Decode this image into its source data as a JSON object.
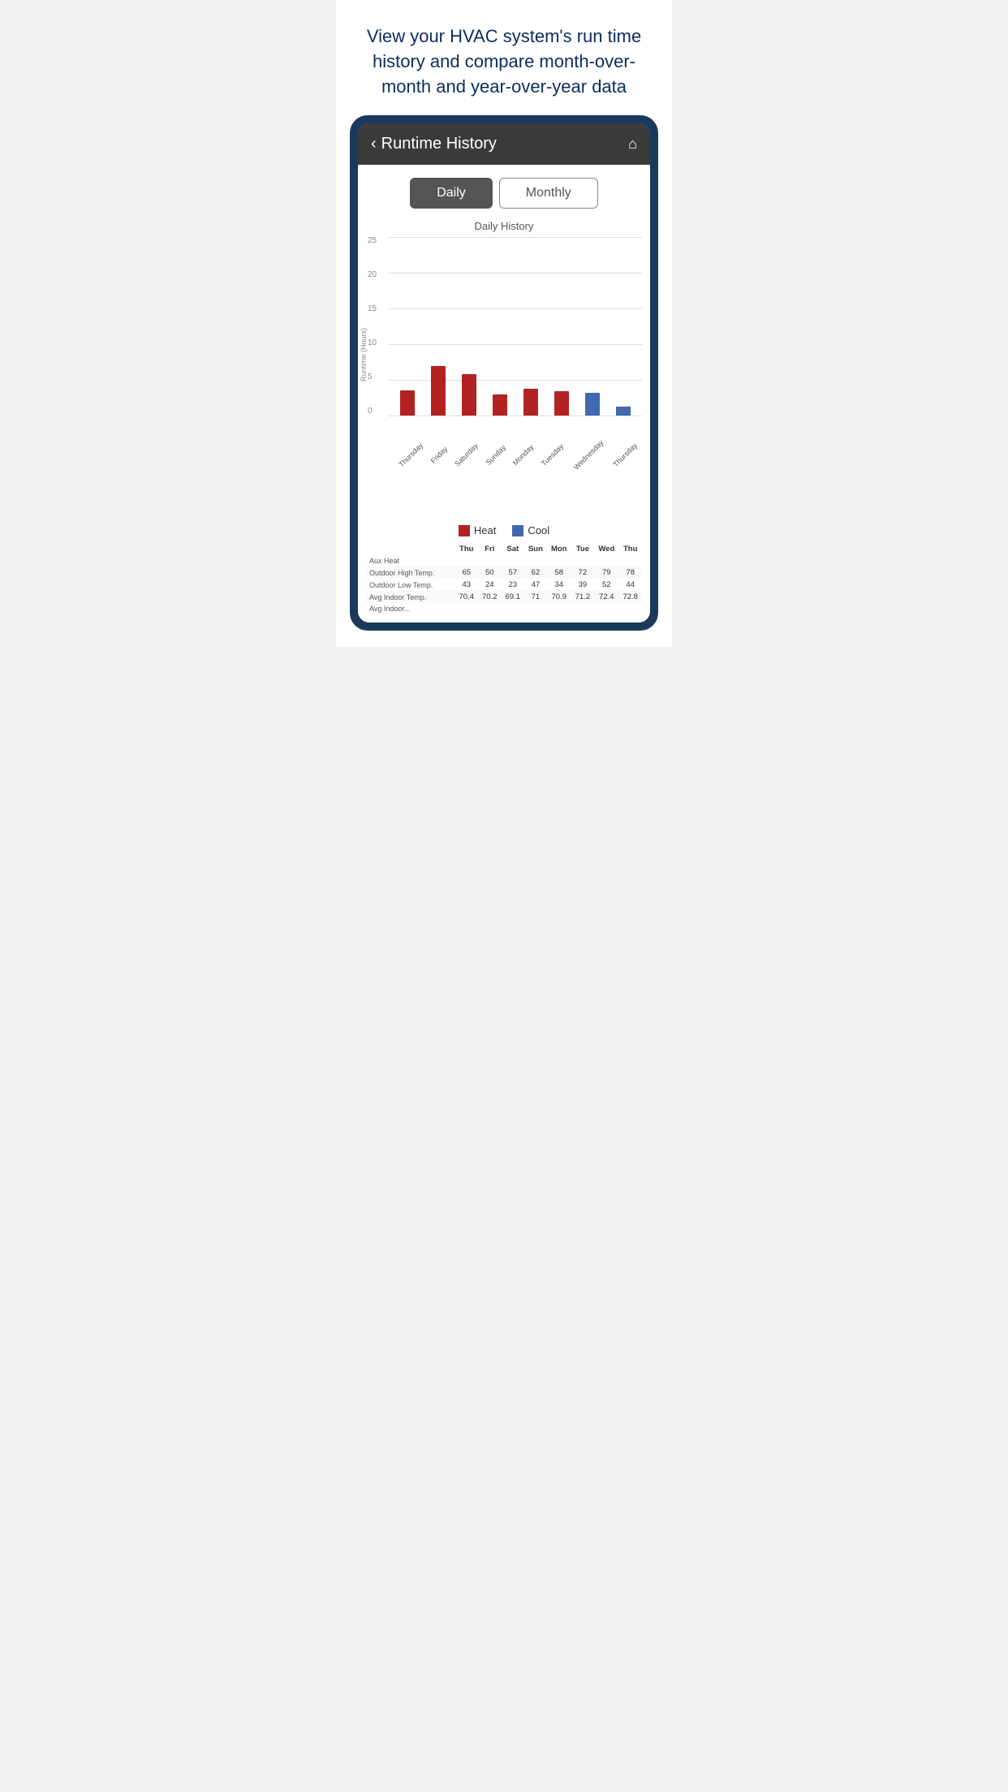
{
  "header": {
    "text": "View your HVAC system's run time history and compare month-over-month and year-over-year data"
  },
  "nav": {
    "back_label": "<",
    "title": "Runtime History",
    "home_icon": "🏠"
  },
  "toggles": {
    "daily_label": "Daily",
    "monthly_label": "Monthly"
  },
  "chart": {
    "title": "Daily History",
    "y_axis_label": "Runtime (Hours)",
    "y_labels": [
      "25",
      "20",
      "15",
      "10",
      "5",
      "0"
    ],
    "max_value": 25,
    "days": [
      "Thursday",
      "Friday",
      "Saturday",
      "Sunday",
      "Monday",
      "Tuesday",
      "Wednesday",
      "Thursday"
    ],
    "heat_values": [
      3.6,
      7.0,
      5.8,
      3.0,
      3.8,
      3.5,
      0,
      0
    ],
    "cool_values": [
      0,
      0,
      0,
      0,
      0,
      0,
      3.2,
      1.3
    ]
  },
  "legend": {
    "heat_label": "Heat",
    "cool_label": "Cool"
  },
  "table": {
    "headers": [
      "",
      "Thu",
      "Fri",
      "Sat",
      "Sun",
      "Mon",
      "Tue",
      "Wed",
      "Thu"
    ],
    "rows": [
      {
        "label": "Aux Heat",
        "values": [
          "",
          "",
          "",
          "",
          "",
          "",
          "",
          ""
        ]
      },
      {
        "label": "Outdoor High Temp.",
        "values": [
          "65",
          "50",
          "57",
          "62",
          "58",
          "72",
          "79",
          "78"
        ]
      },
      {
        "label": "Outdoor Low Temp.",
        "values": [
          "43",
          "24",
          "23",
          "47",
          "34",
          "39",
          "52",
          "44"
        ]
      },
      {
        "label": "Avg Indoor Temp.",
        "values": [
          "70.4",
          "70.2",
          "69.1",
          "71",
          "70.9",
          "71.2",
          "72.4",
          "72.8"
        ]
      },
      {
        "label": "Avg Indoor...",
        "values": [
          "",
          "",
          "",
          "",
          "",
          "",
          "",
          ""
        ]
      }
    ]
  }
}
